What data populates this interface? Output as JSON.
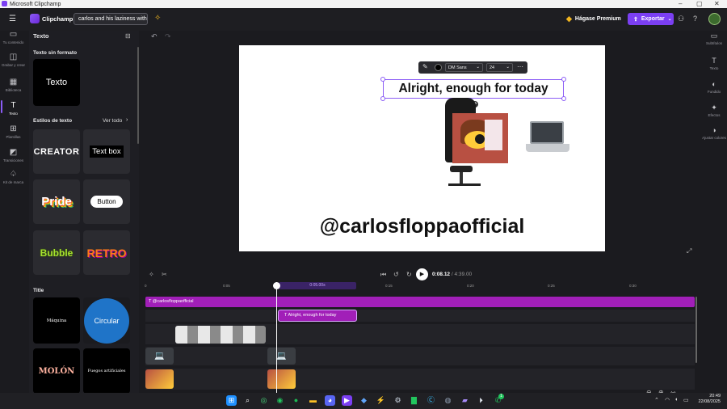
{
  "window": {
    "title": "Microsoft Clipchamp"
  },
  "topbar": {
    "app_name": "Clipchamp",
    "project_title": "carlos and his laziness with t",
    "premium_label": "Hágase Premium",
    "export_label": "Exportar"
  },
  "leftnav": {
    "items": [
      {
        "label": "Tu contenido",
        "icon": "folder-icon"
      },
      {
        "label": "Grabar y crear",
        "icon": "camera-icon"
      },
      {
        "label": "Biblioteca",
        "icon": "library-icon"
      },
      {
        "label": "Texto",
        "icon": "text-icon"
      },
      {
        "label": "Plantillas",
        "icon": "templates-icon"
      },
      {
        "label": "Transiciones",
        "icon": "transitions-icon"
      },
      {
        "label": "Kit de marca",
        "icon": "brand-kit-icon"
      }
    ]
  },
  "panel": {
    "title": "Texto",
    "plain_heading": "Texto sin formato",
    "plain_tile": "Texto",
    "styles_heading": "Estilos de texto",
    "see_all": "Ver todo",
    "styles": [
      "CREATOR",
      "Text box",
      "Pride",
      "Button",
      "Bubble",
      "RETRO"
    ],
    "title_heading": "Title",
    "title_tiles": [
      "Máquina",
      "Circular",
      "MOLÓN",
      "Fuegos artificiales"
    ]
  },
  "stage": {
    "selected_text": "Alright, enough for today",
    "handle_text": "@carlosfloppaofficial",
    "toolbar": {
      "font": "DM Sans",
      "size": "24"
    }
  },
  "playback": {
    "current": "0:08.12",
    "separator": "/",
    "total": "4:39.00"
  },
  "ruler": {
    "marks": [
      "0",
      "0:05",
      "0:10",
      "0:15",
      "0:20",
      "0:25",
      "0:30"
    ],
    "playhead_label": "0:05.00s"
  },
  "timeline": {
    "clip_handle": "@carlosfloppaofficial",
    "clip_selected": "Alright, enough for today"
  },
  "rightnav": {
    "items": [
      {
        "label": "Subtítulos",
        "icon": "captions-icon"
      },
      {
        "label": "Texto",
        "icon": "text-icon"
      },
      {
        "label": "Fundido",
        "icon": "fade-icon"
      },
      {
        "label": "Efectos",
        "icon": "effects-icon"
      },
      {
        "label": "Ajustar colores",
        "icon": "color-adjust-icon"
      }
    ]
  },
  "taskbar": {
    "time": "20:49",
    "date": "22/08/2025",
    "whatsapp_badge": "1"
  },
  "colors": {
    "accent": "#7b3ff2",
    "clip_magenta": "#a11fb8",
    "premium_gold": "#f1b51f"
  }
}
